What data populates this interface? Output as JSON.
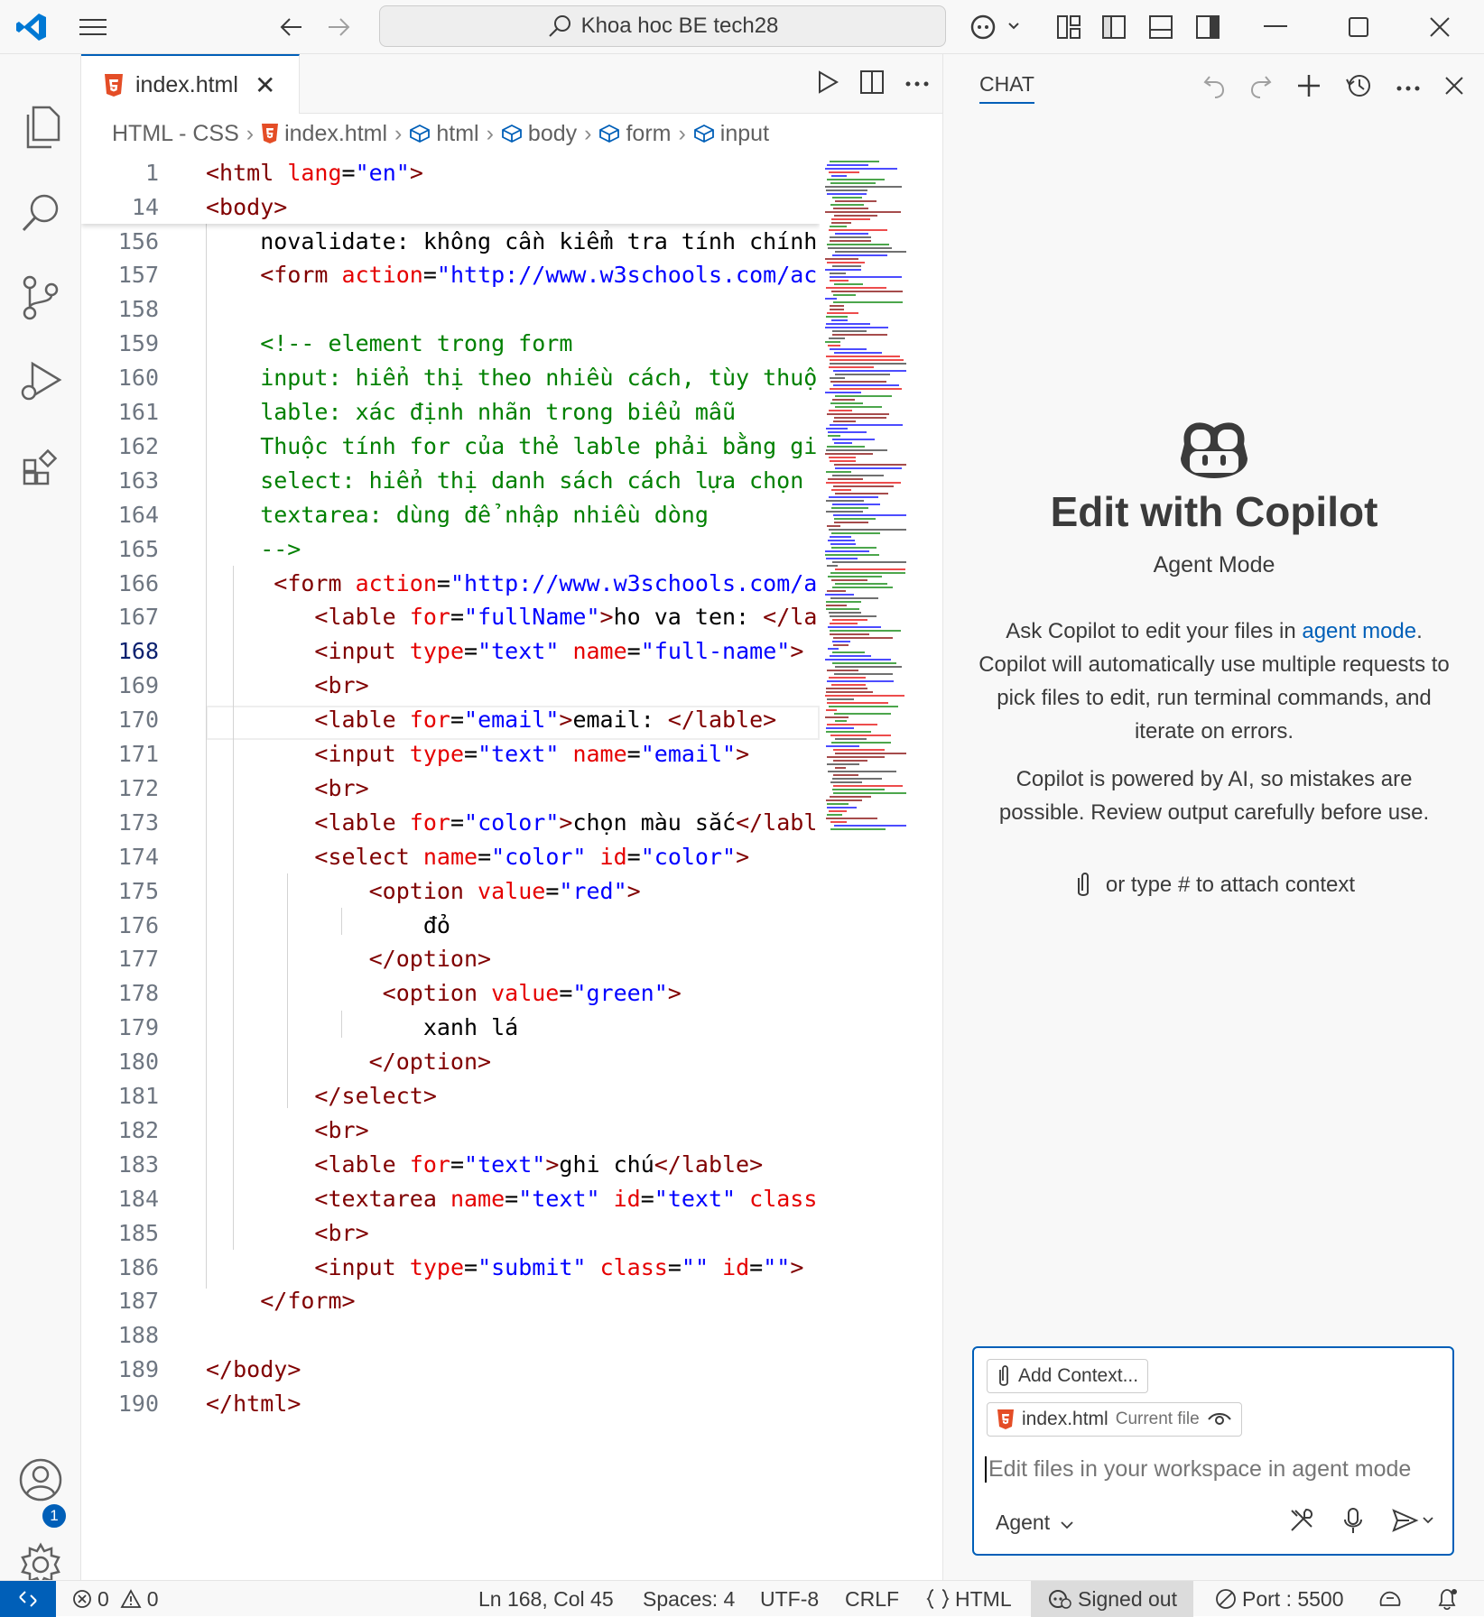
{
  "titlebar": {
    "search_text": "Khoa hoc BE tech28"
  },
  "editor": {
    "tab_label": "index.html",
    "breadcrumb": [
      "HTML - CSS",
      "index.html",
      "html",
      "body",
      "form",
      "input"
    ],
    "sticky_lines": [
      {
        "num": "1",
        "text": "<html lang=\"en\">"
      },
      {
        "num": "14",
        "text": "<body>"
      }
    ],
    "lines": [
      {
        "num": "156",
        "text": "    novalidate: không cần kiểm tra tính chính"
      },
      {
        "num": "157",
        "text": "    <form action=\"http://www.w3schools.com/ac"
      },
      {
        "num": "158",
        "text": ""
      },
      {
        "num": "159",
        "text": "    <!-- element trong form"
      },
      {
        "num": "160",
        "text": "    input: hiển thị theo nhiều cách, tùy thuộ"
      },
      {
        "num": "161",
        "text": "    lable: xác định nhãn trong biểu mẫu"
      },
      {
        "num": "162",
        "text": "    Thuộc tính for của thẻ lable phải bằng gi"
      },
      {
        "num": "163",
        "text": "    select: hiển thị danh sách cách lựa chọn"
      },
      {
        "num": "164",
        "text": "    textarea: dùng để nhập nhiều dòng"
      },
      {
        "num": "165",
        "text": "    -->"
      },
      {
        "num": "166",
        "text": "     <form action=\"http://www.w3schools.com/a"
      },
      {
        "num": "167",
        "text": "        <lable for=\"fullName\">ho va ten: </la"
      },
      {
        "num": "168",
        "text": "        <input type=\"text\" name=\"full-name\">"
      },
      {
        "num": "169",
        "text": "        <br>"
      },
      {
        "num": "170",
        "text": "        <lable for=\"email\">email: </lable>"
      },
      {
        "num": "171",
        "text": "        <input type=\"text\" name=\"email\">"
      },
      {
        "num": "172",
        "text": "        <br>"
      },
      {
        "num": "173",
        "text": "        <lable for=\"color\">chọn màu sắc</labl"
      },
      {
        "num": "174",
        "text": "        <select name=\"color\" id=\"color\">"
      },
      {
        "num": "175",
        "text": "            <option value=\"red\">"
      },
      {
        "num": "176",
        "text": "                đỏ"
      },
      {
        "num": "177",
        "text": "            </option>"
      },
      {
        "num": "178",
        "text": "             <option value=\"green\">"
      },
      {
        "num": "179",
        "text": "                xanh lá"
      },
      {
        "num": "180",
        "text": "            </option>"
      },
      {
        "num": "181",
        "text": "        </select>"
      },
      {
        "num": "182",
        "text": "        <br>"
      },
      {
        "num": "183",
        "text": "        <lable for=\"text\">ghi chú</lable>"
      },
      {
        "num": "184",
        "text": "        <textarea name=\"text\" id=\"text\" class"
      },
      {
        "num": "185",
        "text": "        <br>"
      },
      {
        "num": "186",
        "text": "        <input type=\"submit\" class=\"\" id=\"\">"
      },
      {
        "num": "187",
        "text": "    </form>"
      },
      {
        "num": "188",
        "text": ""
      },
      {
        "num": "189",
        "text": "</body>"
      },
      {
        "num": "190",
        "text": "</html>"
      }
    ],
    "current_line": "168"
  },
  "chat": {
    "tab_label": "CHAT",
    "heading": "Edit with Copilot",
    "mode_label": "Agent Mode",
    "intro_before_link": "Ask Copilot to edit your files in ",
    "intro_link": "agent mode",
    "intro_after_link": ". Copilot will automatically use multiple requests to pick files to edit, run terminal commands, and iterate on errors.",
    "disclaimer": "Copilot is powered by AI, so mistakes are possible. Review output carefully before use.",
    "attach_hint": "or type # to attach context",
    "add_context_label": "Add Context...",
    "file_chip_name": "index.html",
    "file_chip_note": "Current file",
    "input_placeholder": "Edit files in your workspace in agent mode",
    "agent_selector": "Agent"
  },
  "statusbar": {
    "errors": "0",
    "warnings": "0",
    "position": "Ln 168, Col 45",
    "spaces": "Spaces: 4",
    "encoding": "UTF-8",
    "eol": "CRLF",
    "language": "HTML",
    "account": "Signed out",
    "port": "Port : 5500"
  },
  "accounts_badge": "1",
  "colors": {
    "accent": "#005fb8",
    "tag": "#800000",
    "attribute": "#e50000",
    "string": "#0000ff",
    "comment": "#008000",
    "html5_icon": "#e44d26"
  }
}
